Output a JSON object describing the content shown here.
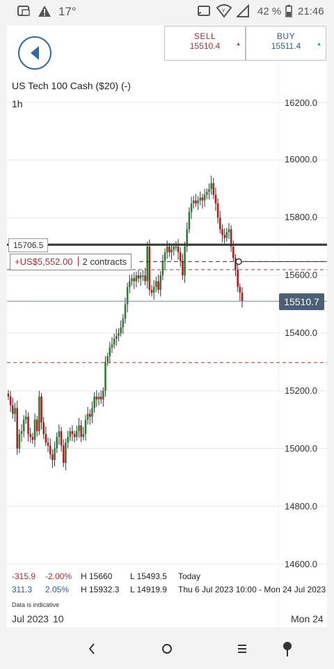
{
  "status_bar": {
    "temperature": "17°",
    "battery": "42 %",
    "time": "21:46",
    "icons": [
      "screenshot-icon",
      "warning-icon",
      "cast-icon",
      "wifi-icon",
      "signal-icon",
      "battery-icon"
    ]
  },
  "header": {
    "back_icon": "back-arrow-icon",
    "sell": {
      "label": "SELL",
      "price": "15510.4",
      "arrow": "▲"
    },
    "buy": {
      "label": "BUY",
      "price": "15511.4",
      "arrow": "▲"
    }
  },
  "instrument": {
    "title": "US Tech 100 Cash ($20) (-)",
    "timeframe": "1h"
  },
  "position": {
    "entry_price": "15706.5",
    "pnl": "+US$5,552.00",
    "contracts": "2 contracts"
  },
  "current_price": "15510.7",
  "stats": {
    "row1": {
      "change": "-315.9",
      "change_pct": "-2.00%",
      "high": "H 15660",
      "low": "L 15493.5",
      "period": "Today"
    },
    "row2": {
      "change": "311.3",
      "change_pct": "2.05%",
      "high": "H 15932.3",
      "low": "L 14919.9",
      "period": "Thu 6 Jul 2023 10:00 - Mon 24 Jul 2023"
    }
  },
  "disclaimer": "Data is indicative",
  "x_axis": {
    "left": "Jul 2023",
    "mid": "10",
    "right": "Mon 24"
  },
  "colors": {
    "up": "#2e7d32",
    "down": "#b71c1c",
    "accent": "#2f6bab",
    "price_tag": "#4b5f78"
  },
  "nav": {
    "icons": [
      "back-nav-icon",
      "home-nav-icon",
      "recents-nav-icon",
      "assistant-nav-icon"
    ]
  },
  "chart_data": {
    "type": "candlestick",
    "ylim": [
      14560,
      16300
    ],
    "y_ticks": [
      "16200.0",
      "16000.0",
      "15800.0",
      "15600.0",
      "15400.0",
      "15200.0",
      "15000.0",
      "14800.0",
      "14600.0"
    ],
    "y_tick_values": [
      16200,
      16000,
      15800,
      15600,
      15400,
      15200,
      15000,
      14800,
      14600
    ],
    "reference_lines": {
      "entry": 15706.5,
      "current": 15510.7,
      "dashed_red": [
        15620,
        15298
      ],
      "dashed_black": 15648
    },
    "closes": [
      15180,
      15150,
      15120,
      15140,
      15000,
      15050,
      15060,
      15100,
      15110,
      15050,
      15040,
      15030,
      15100,
      15060,
      15180,
      15090,
      15050,
      15020,
      15010,
      14980,
      14960,
      15000,
      15040,
      15060,
      15010,
      14950,
      15020,
      15040,
      15060,
      15050,
      15040,
      15060,
      15080,
      15040,
      15050,
      15100,
      15120,
      15110,
      15140,
      15180,
      15170,
      15180,
      15170,
      15200,
      15300,
      15320,
      15350,
      15360,
      15380,
      15390,
      15400,
      15420,
      15450,
      15500,
      15560,
      15580,
      15590,
      15580,
      15600,
      15590,
      15600,
      15600,
      15580,
      15700,
      15550,
      15540,
      15560,
      15580,
      15550,
      15600,
      15650,
      15680,
      15700,
      15680,
      15690,
      15700,
      15700,
      15680,
      15650,
      15600,
      15700,
      15760,
      15820,
      15850,
      15860,
      15850,
      15860,
      15870,
      15860,
      15880,
      15890,
      15900,
      15920,
      15880,
      15850,
      15800,
      15760,
      15740,
      15730,
      15750,
      15760,
      15700,
      15660,
      15620,
      15560,
      15540,
      15510.7
    ]
  }
}
